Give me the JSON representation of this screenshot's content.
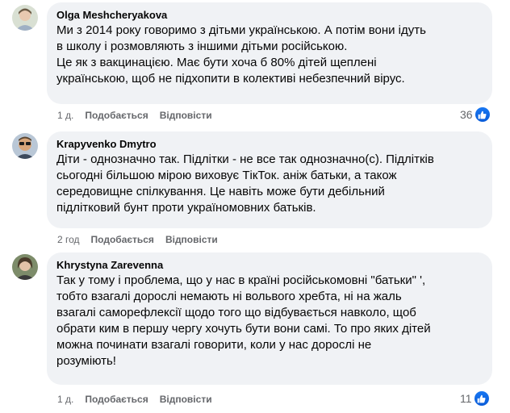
{
  "comments": [
    {
      "author": "Olga Meshcheryakova",
      "text": "Ми з 2014 року говоримо з дітьми українською. А потім вони ідуть\nв школу і розмовляють з іншими дітьми російською.\nЦе як з вакцинацією. Має бути хоча б 80% дітей щеплені\nукраїнською, щоб не підхопити в колективі небезпечний вірус.",
      "time": "1 д.",
      "like_label": "Подобається",
      "reply_label": "Відповісти",
      "reactions": "36",
      "avatar_color": "#b7a58c"
    },
    {
      "author": "Krapyvenko Dmytro",
      "text": "Діти - однозначно так. Підлітки - не все так однозначно(с). Підлітків\nсьогодні більшою мірою виховує ТікТок. аніж батьки, а також\nсередовищне спілкування. Це навіть може бути дебільний\nпідлітковий бунт проти україномовних батьків.",
      "time": "2 год",
      "like_label": "Подобається",
      "reply_label": "Відповісти",
      "reactions": "",
      "avatar_color": "#c8a27a"
    },
    {
      "author": "Khrystyna Zarevenna",
      "text": "Так у тому і проблема, що у нас в країні російськомовні \"батьки\" ',\nтобто взагалі дорослі немають ні вольвого хребта, ні на жаль\nвзагалі саморефлексії щодо того що відбувається навколо, щоб\nобрати ким в першу чергу хочуть бути вони самі. То про яких дітей\nможна починати взагалі говорити, коли у нас дорослі не\nрозуміють!",
      "time": "1 д.",
      "like_label": "Подобається",
      "reply_label": "Відповісти",
      "reactions": "11",
      "avatar_color": "#8a8f7a"
    }
  ],
  "colors": {
    "bubble": "#f0f2f5",
    "meta": "#65676b",
    "like_blue": "#1877f2"
  }
}
